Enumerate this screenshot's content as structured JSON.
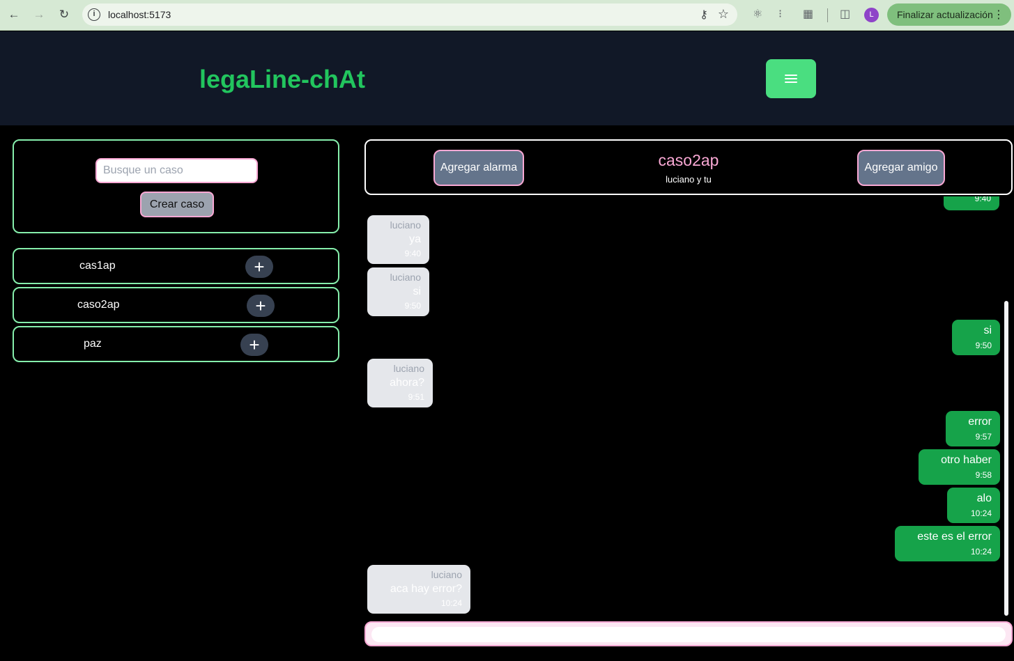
{
  "browser": {
    "url": "localhost:5173",
    "profile_initial": "L",
    "update_label": "Finalizar actualización"
  },
  "app": {
    "brand": "legaLine-chAt"
  },
  "sidebar": {
    "search_placeholder": "Busque un caso",
    "create_label": "Crear caso",
    "cases": [
      {
        "name": "cas1ap"
      },
      {
        "name": "caso2ap"
      },
      {
        "name": "paz"
      }
    ]
  },
  "chat": {
    "alarm_label": "Agregar alarma",
    "friend_label": "Agregar amigo",
    "title": "caso2ap",
    "subtitle": "luciano y tu",
    "messages": [
      {
        "dir": "out",
        "text": "",
        "time": "9:40"
      },
      {
        "dir": "in",
        "author": "luciano",
        "text": "ya",
        "time": "9:40"
      },
      {
        "dir": "in",
        "author": "luciano",
        "text": "si",
        "time": "9:50"
      },
      {
        "dir": "out",
        "text": "si",
        "time": "9:50"
      },
      {
        "dir": "in",
        "author": "luciano",
        "text": "ahora?",
        "time": "9:51"
      },
      {
        "dir": "out",
        "text": "error",
        "time": "9:57"
      },
      {
        "dir": "out",
        "text": "otro haber",
        "time": "9:58"
      },
      {
        "dir": "out",
        "text": "alo",
        "time": "10:24"
      },
      {
        "dir": "out",
        "text": "este es el error",
        "time": "10:24"
      },
      {
        "dir": "in",
        "author": "luciano",
        "text": "aca hay error?",
        "time": "10:24"
      }
    ],
    "composer_value": ""
  }
}
